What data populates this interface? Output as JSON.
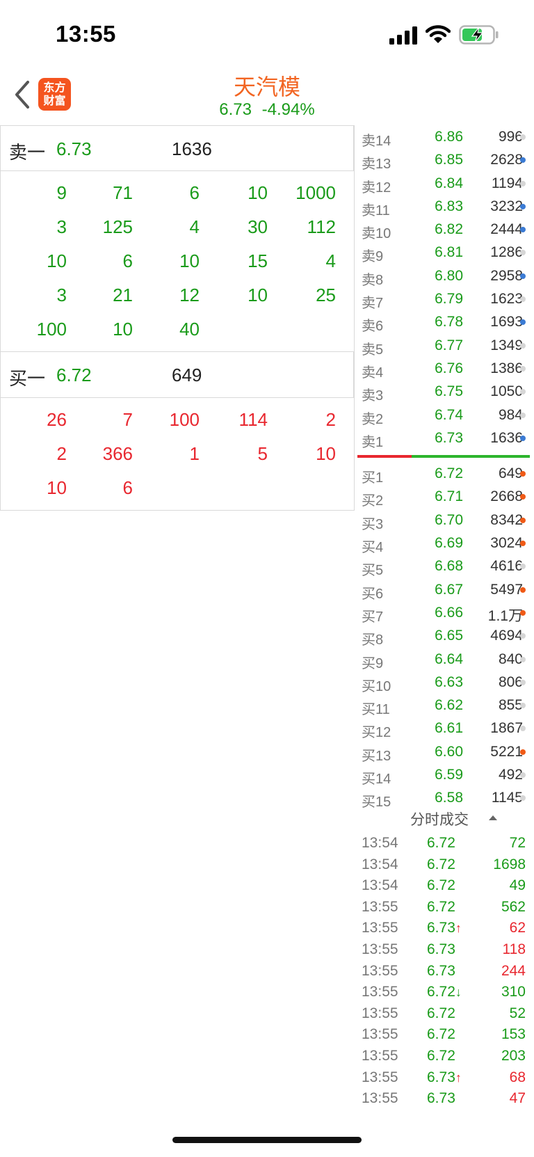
{
  "status_bar": {
    "time": "13:55"
  },
  "header": {
    "logo_text_line1": "东方",
    "logo_text_line2": "财富",
    "stock_name": "天汽模",
    "price": "6.73",
    "change_pct": "-4.94%"
  },
  "left_panel": {
    "sell_label": "卖一",
    "sell_price": "6.73",
    "sell_volume": "1636",
    "sell_orders": [
      [
        "9",
        "71",
        "6",
        "10",
        "1000"
      ],
      [
        "3",
        "125",
        "4",
        "30",
        "112"
      ],
      [
        "10",
        "6",
        "10",
        "15",
        "4"
      ],
      [
        "3",
        "21",
        "12",
        "10",
        "25"
      ],
      [
        "100",
        "10",
        "40",
        "",
        ""
      ]
    ],
    "buy_label": "买一",
    "buy_price": "6.72",
    "buy_volume": "649",
    "buy_orders": [
      [
        "26",
        "7",
        "100",
        "114",
        "2"
      ],
      [
        "2",
        "366",
        "1",
        "5",
        "10"
      ],
      [
        "10",
        "6",
        "",
        "",
        ""
      ]
    ]
  },
  "order_book": {
    "asks": [
      {
        "label": "卖14",
        "price": "6.86",
        "vol": "996",
        "dot": "gray"
      },
      {
        "label": "卖13",
        "price": "6.85",
        "vol": "2628",
        "dot": "blue"
      },
      {
        "label": "卖12",
        "price": "6.84",
        "vol": "1194",
        "dot": "gray"
      },
      {
        "label": "卖11",
        "price": "6.83",
        "vol": "3232",
        "dot": "blue"
      },
      {
        "label": "卖10",
        "price": "6.82",
        "vol": "2444",
        "dot": "blue"
      },
      {
        "label": "卖9",
        "price": "6.81",
        "vol": "1286",
        "dot": "gray"
      },
      {
        "label": "卖8",
        "price": "6.80",
        "vol": "2958",
        "dot": "blue"
      },
      {
        "label": "卖7",
        "price": "6.79",
        "vol": "1623",
        "dot": "gray"
      },
      {
        "label": "卖6",
        "price": "6.78",
        "vol": "1693",
        "dot": "blue"
      },
      {
        "label": "卖5",
        "price": "6.77",
        "vol": "1349",
        "dot": "gray"
      },
      {
        "label": "卖4",
        "price": "6.76",
        "vol": "1386",
        "dot": "gray"
      },
      {
        "label": "卖3",
        "price": "6.75",
        "vol": "1050",
        "dot": "gray"
      },
      {
        "label": "卖2",
        "price": "6.74",
        "vol": "984",
        "dot": "gray"
      },
      {
        "label": "卖1",
        "price": "6.73",
        "vol": "1636",
        "dot": "blue"
      }
    ],
    "bids": [
      {
        "label": "买1",
        "price": "6.72",
        "vol": "649",
        "dot": "orange"
      },
      {
        "label": "买2",
        "price": "6.71",
        "vol": "2668",
        "dot": "orange"
      },
      {
        "label": "买3",
        "price": "6.70",
        "vol": "8342",
        "dot": "orange"
      },
      {
        "label": "买4",
        "price": "6.69",
        "vol": "3024",
        "dot": "orange"
      },
      {
        "label": "买5",
        "price": "6.68",
        "vol": "4616",
        "dot": "gray"
      },
      {
        "label": "买6",
        "price": "6.67",
        "vol": "5497",
        "dot": "orange"
      },
      {
        "label": "买7",
        "price": "6.66",
        "vol": "1.1万",
        "dot": "orange"
      },
      {
        "label": "买8",
        "price": "6.65",
        "vol": "4694",
        "dot": "gray"
      },
      {
        "label": "买9",
        "price": "6.64",
        "vol": "840",
        "dot": "gray"
      },
      {
        "label": "买10",
        "price": "6.63",
        "vol": "806",
        "dot": "gray"
      },
      {
        "label": "买11",
        "price": "6.62",
        "vol": "855",
        "dot": "gray"
      },
      {
        "label": "买12",
        "price": "6.61",
        "vol": "1867",
        "dot": "gray"
      },
      {
        "label": "买13",
        "price": "6.60",
        "vol": "5221",
        "dot": "orange"
      },
      {
        "label": "买14",
        "price": "6.59",
        "vol": "492",
        "dot": "gray"
      },
      {
        "label": "买15",
        "price": "6.58",
        "vol": "1145",
        "dot": "gray"
      }
    ]
  },
  "ticks": {
    "title": "分时成交",
    "rows": [
      {
        "time": "13:54",
        "price": "6.72",
        "arrow": "",
        "vol": "72",
        "color": "green"
      },
      {
        "time": "13:54",
        "price": "6.72",
        "arrow": "",
        "vol": "1698",
        "color": "green"
      },
      {
        "time": "13:54",
        "price": "6.72",
        "arrow": "",
        "vol": "49",
        "color": "green"
      },
      {
        "time": "13:55",
        "price": "6.72",
        "arrow": "",
        "vol": "562",
        "color": "green"
      },
      {
        "time": "13:55",
        "price": "6.73",
        "arrow": "↑",
        "vol": "62",
        "color": "red"
      },
      {
        "time": "13:55",
        "price": "6.73",
        "arrow": "",
        "vol": "118",
        "color": "red"
      },
      {
        "time": "13:55",
        "price": "6.73",
        "arrow": "",
        "vol": "244",
        "color": "red"
      },
      {
        "time": "13:55",
        "price": "6.72",
        "arrow": "↓",
        "vol": "310",
        "color": "green"
      },
      {
        "time": "13:55",
        "price": "6.72",
        "arrow": "",
        "vol": "52",
        "color": "green"
      },
      {
        "time": "13:55",
        "price": "6.72",
        "arrow": "",
        "vol": "153",
        "color": "green"
      },
      {
        "time": "13:55",
        "price": "6.72",
        "arrow": "",
        "vol": "203",
        "color": "green"
      },
      {
        "time": "13:55",
        "price": "6.73",
        "arrow": "↑",
        "vol": "68",
        "color": "red"
      },
      {
        "time": "13:55",
        "price": "6.73",
        "arrow": "",
        "vol": "47",
        "color": "red"
      }
    ]
  },
  "colors": {
    "up": "#e8272f",
    "down": "#1a9b1a",
    "accent": "#f26522"
  }
}
